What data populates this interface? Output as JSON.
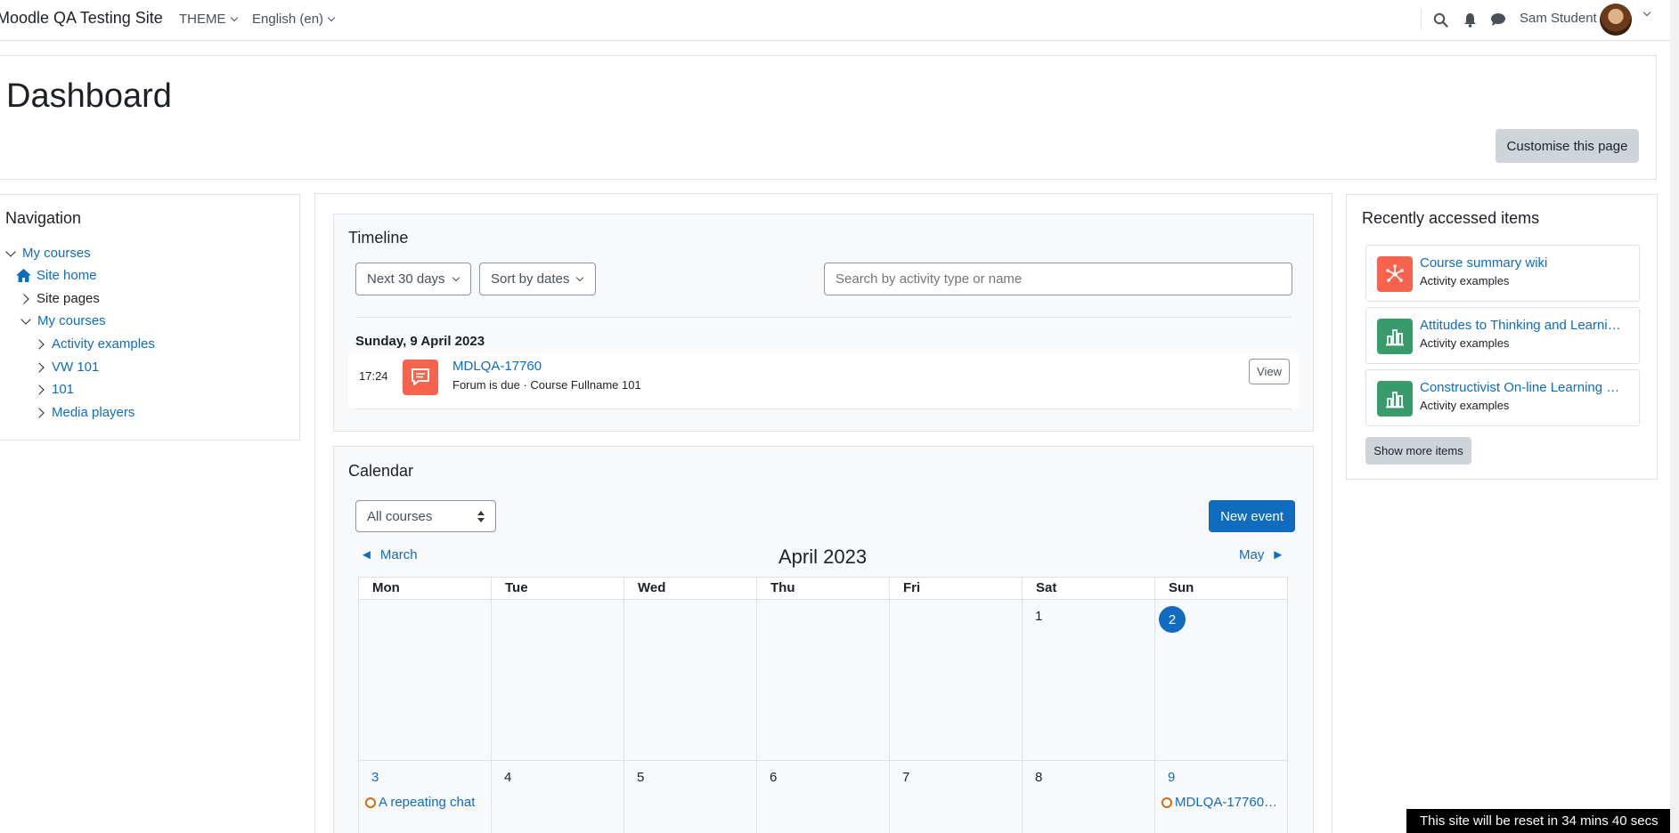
{
  "navbar": {
    "brand": "Moodle QA Testing Site",
    "menu": [
      {
        "label": "THEME"
      },
      {
        "label": "English (en)"
      }
    ],
    "user_name": "Sam Student"
  },
  "header": {
    "title": "Dashboard",
    "customise_label": "Customise this page"
  },
  "navigation": {
    "title": "Navigation",
    "items": [
      {
        "label": "My courses"
      },
      {
        "label": "Site home"
      },
      {
        "label": "Site pages"
      },
      {
        "label": "My courses"
      },
      {
        "label": "Activity examples"
      },
      {
        "label": "VW 101"
      },
      {
        "label": "101"
      },
      {
        "label": "Media players"
      }
    ]
  },
  "timeline": {
    "title": "Timeline",
    "filter_label": "Next 30 days",
    "sort_label": "Sort by dates",
    "search_placeholder": "Search by activity type or name",
    "date_heading": "Sunday, 9 April 2023",
    "event": {
      "time": "17:24",
      "title": "MDLQA-17760",
      "subtitle": "Forum is due · Course Fullname 101",
      "action": "View"
    }
  },
  "calendar": {
    "title": "Calendar",
    "course_filter": "All courses",
    "new_event_label": "New event",
    "prev_label": "March",
    "next_label": "May",
    "month_label": "April 2023",
    "day_headers": [
      "Mon",
      "Tue",
      "Wed",
      "Thu",
      "Fri",
      "Sat",
      "Sun"
    ],
    "week1": [
      "",
      "",
      "",
      "",
      "",
      "1",
      "2"
    ],
    "week2": [
      "3",
      "4",
      "5",
      "6",
      "7",
      "8",
      "9"
    ],
    "events": [
      {
        "label": "A repeating chat"
      },
      {
        "label": "MDLQA-17760…"
      }
    ]
  },
  "recent": {
    "title": "Recently accessed items",
    "items": [
      {
        "title": "Course summary wiki",
        "subtitle": "Activity examples",
        "color": "#f7634d"
      },
      {
        "title": "Attitudes to Thinking and Learning Survey",
        "subtitle": "Activity examples",
        "color": "#399b6c"
      },
      {
        "title": "Constructivist On-line Learning Environment Survey",
        "subtitle": "Activity examples",
        "color": "#399b6c"
      }
    ],
    "show_more_label": "Show more items"
  },
  "reset_banner": "This site will be reset in 34 mins 40 secs",
  "colors": {
    "link": "#0f6cbf",
    "primary": "#0f6cbf",
    "event_red": "#f7634d",
    "survey_green": "#399b6c"
  }
}
